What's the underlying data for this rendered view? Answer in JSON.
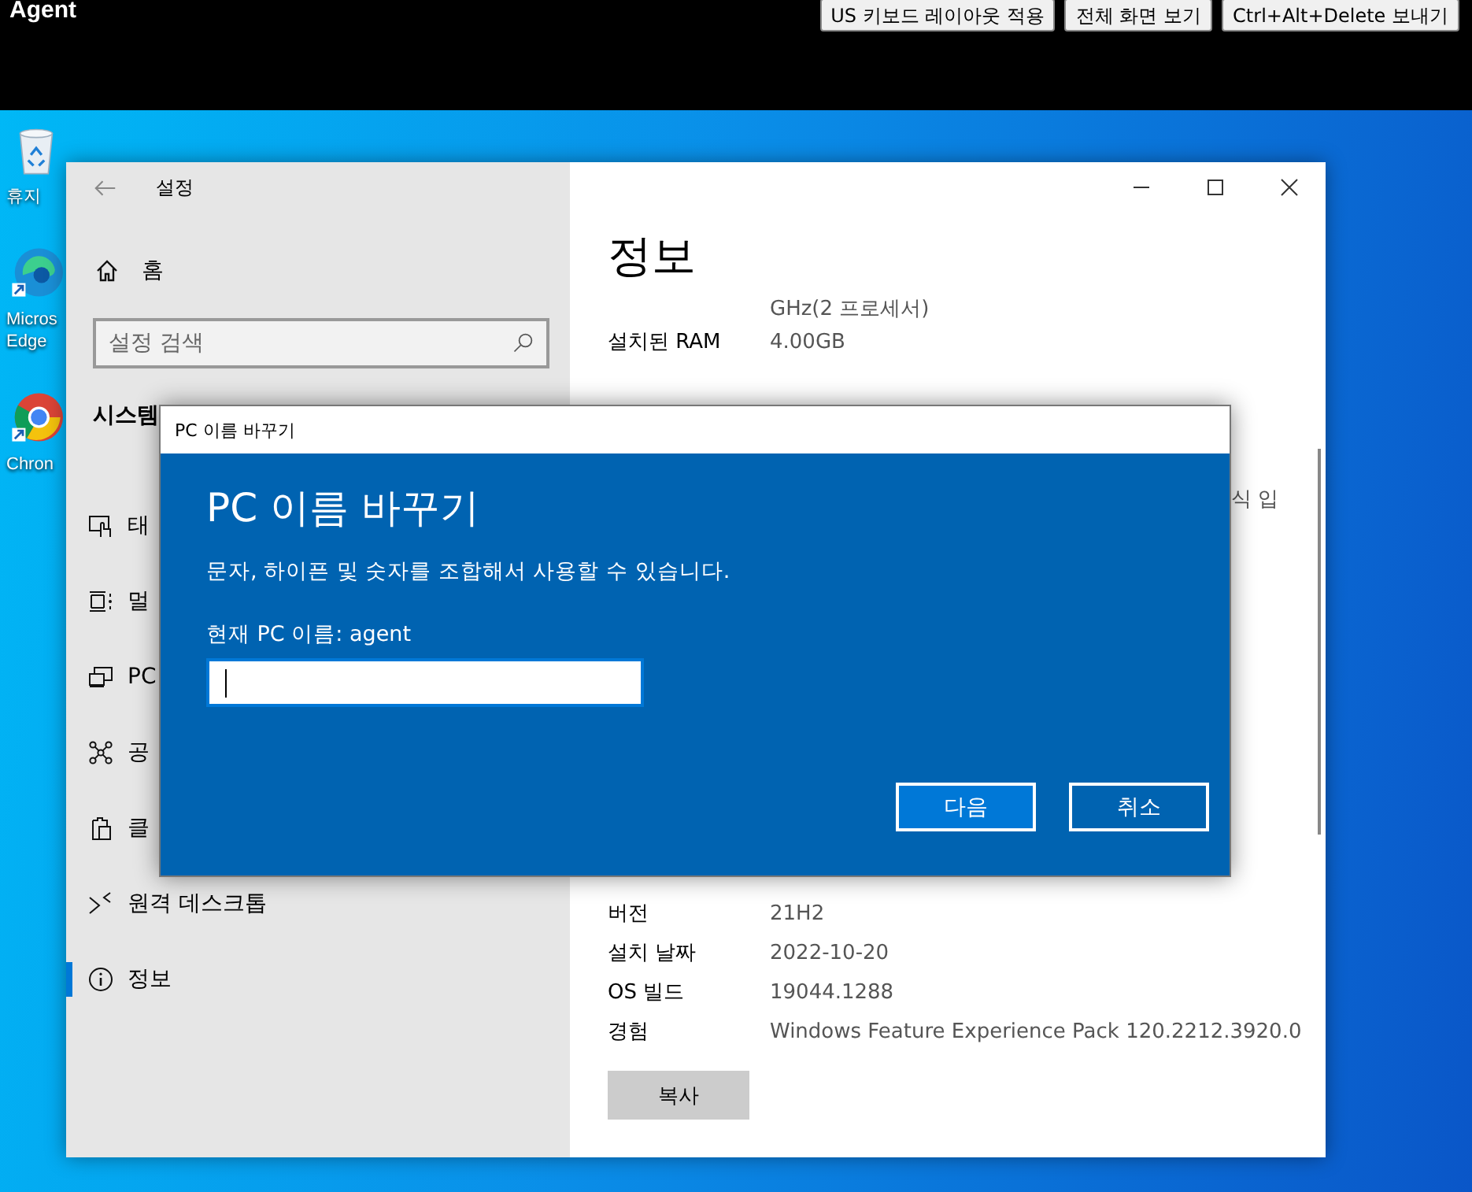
{
  "remote_toolbar": {
    "title": "Agent",
    "buttons": [
      {
        "label": "US 키보드 레이아웃 적용"
      },
      {
        "label": "전체 화면 보기"
      },
      {
        "label": "Ctrl+Alt+Delete 보내기"
      }
    ]
  },
  "desktop_icons": [
    {
      "kind": "recycle-bin",
      "label_lines": [
        "휴지"
      ]
    },
    {
      "kind": "edge",
      "label_lines": [
        "Micros",
        "Edge"
      ]
    },
    {
      "kind": "chrome",
      "label_lines": [
        "Chron"
      ]
    }
  ],
  "settings_window": {
    "title": "설정",
    "home": "홈",
    "search": {
      "placeholder": "설정 검색"
    },
    "section": "시스템",
    "items": [
      {
        "kind": "tablet",
        "label": "태",
        "selected": false
      },
      {
        "kind": "multitask",
        "label": "멀",
        "selected": false
      },
      {
        "kind": "project",
        "label": "PC",
        "selected": false
      },
      {
        "kind": "shared",
        "label": "공",
        "selected": false
      },
      {
        "kind": "clipboard",
        "label": "클",
        "selected": false
      },
      {
        "kind": "remote",
        "label": "원격 데스크톱",
        "selected": false
      },
      {
        "kind": "info",
        "label": "정보",
        "selected": true
      }
    ],
    "page_title": "정보",
    "processor_value_tail": "GHz(2 프로세서)",
    "specs_top": [
      {
        "label": "설치된 RAM",
        "value": "4.00GB"
      }
    ],
    "obscured_fragment": "식 입",
    "specs": [
      {
        "label": "버전",
        "value": "21H2"
      },
      {
        "label": "설치 날짜",
        "value": "2022-10-20"
      },
      {
        "label": "OS 빌드",
        "value": "19044.1288"
      },
      {
        "label": "경험",
        "value": "Windows Feature Experience Pack 120.2212.3920.0"
      }
    ],
    "copy_button": "복사"
  },
  "dialog": {
    "title": "PC 이름 바꾸기",
    "heading": "PC 이름 바꾸기",
    "description": "문자, 하이픈 및 숫자를 조합해서 사용할 수 있습니다.",
    "current_name_label": "현재 PC 이름: agent",
    "buttons": [
      {
        "label": "다음",
        "primary": true
      },
      {
        "label": "취소",
        "primary": false
      }
    ]
  }
}
